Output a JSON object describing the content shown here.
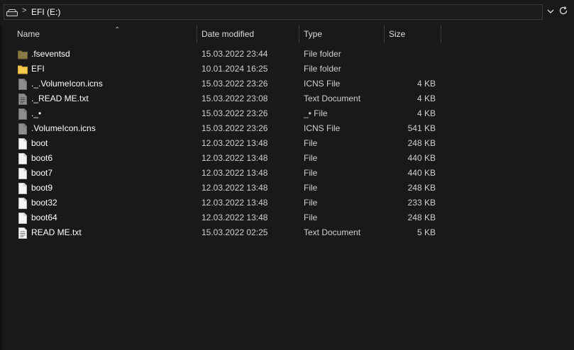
{
  "address": {
    "path": "EFI (E:)"
  },
  "columns": {
    "name": "Name",
    "date": "Date modified",
    "type": "Type",
    "size": "Size"
  },
  "files": [
    {
      "name": ".fseventsd",
      "date": "15.03.2022 23:44",
      "type": "File folder",
      "size": "",
      "icon": "folder-dim-icon"
    },
    {
      "name": "EFI",
      "date": "10.01.2024 16:25",
      "type": "File folder",
      "size": "",
      "icon": "folder-icon"
    },
    {
      "name": "._.VolumeIcon.icns",
      "date": "15.03.2022 23:26",
      "type": "ICNS File",
      "size": "4 KB",
      "icon": "file-dim-icon"
    },
    {
      "name": "._READ ME.txt",
      "date": "15.03.2022 23:08",
      "type": "Text Document",
      "size": "4 KB",
      "icon": "text-file-dim-icon"
    },
    {
      "name": "._•",
      "date": "15.03.2022 23:26",
      "type": "_• File",
      "size": "4 KB",
      "icon": "file-dim-icon"
    },
    {
      "name": ".VolumeIcon.icns",
      "date": "15.03.2022 23:26",
      "type": "ICNS File",
      "size": "541 KB",
      "icon": "file-dim-icon"
    },
    {
      "name": "boot",
      "date": "12.03.2022 13:48",
      "type": "File",
      "size": "248 KB",
      "icon": "file-icon"
    },
    {
      "name": "boot6",
      "date": "12.03.2022 13:48",
      "type": "File",
      "size": "440 KB",
      "icon": "file-icon"
    },
    {
      "name": "boot7",
      "date": "12.03.2022 13:48",
      "type": "File",
      "size": "440 KB",
      "icon": "file-icon"
    },
    {
      "name": "boot9",
      "date": "12.03.2022 13:48",
      "type": "File",
      "size": "248 KB",
      "icon": "file-icon"
    },
    {
      "name": "boot32",
      "date": "12.03.2022 13:48",
      "type": "File",
      "size": "233 KB",
      "icon": "file-icon"
    },
    {
      "name": "boot64",
      "date": "12.03.2022 13:48",
      "type": "File",
      "size": "248 KB",
      "icon": "file-icon"
    },
    {
      "name": "READ ME.txt",
      "date": "15.03.2022 02:25",
      "type": "Text Document",
      "size": "5 KB",
      "icon": "text-file-icon"
    }
  ]
}
